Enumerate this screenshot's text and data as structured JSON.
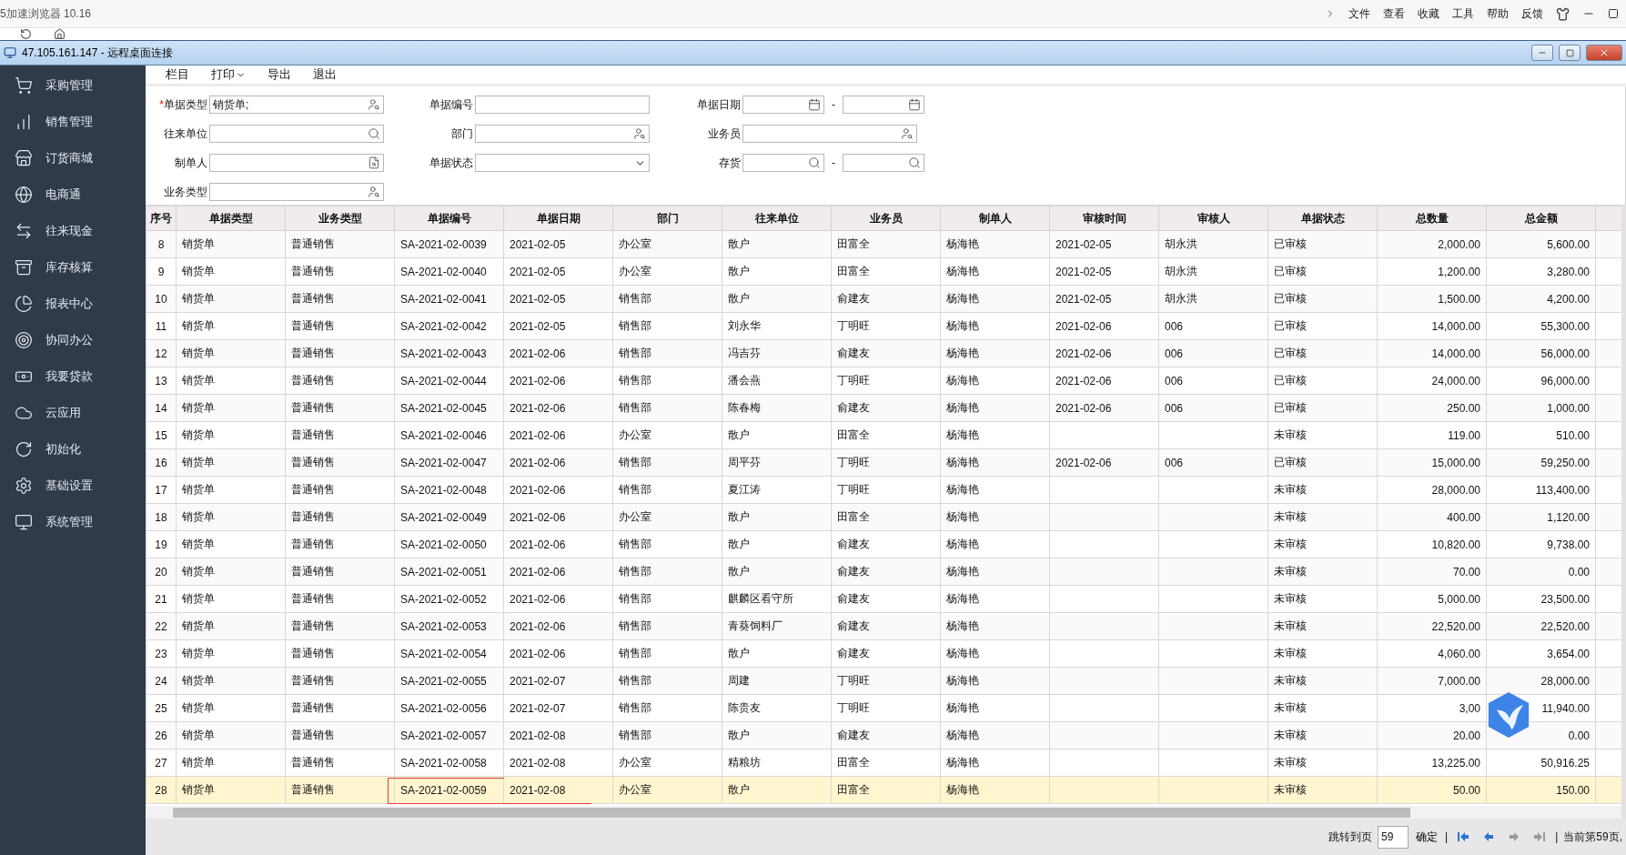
{
  "browser": {
    "title": "5加速浏览器 10.16",
    "menu": [
      "文件",
      "查看",
      "收藏",
      "工具",
      "帮助",
      "反馈"
    ]
  },
  "remote_window": {
    "title": "47.105.161.147 - 远程桌面连接"
  },
  "sidebar": {
    "items": [
      {
        "label": "采购管理"
      },
      {
        "label": "销售管理"
      },
      {
        "label": "订货商城"
      },
      {
        "label": "电商通"
      },
      {
        "label": "往来现金"
      },
      {
        "label": "库存核算"
      },
      {
        "label": "报表中心"
      },
      {
        "label": "协同办公"
      },
      {
        "label": "我要贷款"
      },
      {
        "label": "云应用"
      },
      {
        "label": "初始化"
      },
      {
        "label": "基础设置"
      },
      {
        "label": "系统管理"
      }
    ]
  },
  "toolbar": [
    {
      "label": "栏目",
      "dropdown": false
    },
    {
      "label": "打印",
      "dropdown": true
    },
    {
      "label": "导出",
      "dropdown": false
    },
    {
      "label": "退出",
      "dropdown": false
    }
  ],
  "filters": [
    {
      "required_mark": "*",
      "label": "单据类型",
      "kind": "lookup",
      "value": "销货单;"
    },
    {
      "label": "单据编号",
      "kind": "text"
    },
    {
      "label": "单据日期",
      "kind": "range",
      "separator": "-"
    },
    {
      "label": "往来单位",
      "kind": "lookup"
    },
    {
      "label": "部门",
      "kind": "lookup"
    },
    {
      "label": "业务员",
      "kind": "lookup"
    },
    {
      "label": "制单人",
      "kind": "lookup"
    },
    {
      "label": "单据状态",
      "kind": "select"
    },
    {
      "label": "存货",
      "kind": "range",
      "separator": "-"
    },
    {
      "label": "业务类型",
      "kind": "lookup"
    }
  ],
  "table": {
    "columns": [
      "序号",
      "单据类型",
      "业务类型",
      "单据编号",
      "单据日期",
      "部门",
      "往来单位",
      "业务员",
      "制单人",
      "审核时间",
      "审核人",
      "单据状态",
      "总数量",
      "总金额"
    ],
    "rows": [
      {
        "selected": false,
        "marked": false,
        "seq": "8",
        "doc_type": "销货单",
        "biz_type": "普通销售",
        "doc_no": "SA-2021-02-0039",
        "doc_date": "2021-02-05",
        "dept": "办公室",
        "partner": "散户",
        "salesman": "田富全",
        "maker": "杨海艳",
        "audit_time": "2021-02-05",
        "auditor": "胡永洪",
        "status": "已审核",
        "qty": "2,000.00",
        "amount": "5,600.00"
      },
      {
        "selected": false,
        "marked": false,
        "seq": "9",
        "doc_type": "销货单",
        "biz_type": "普通销售",
        "doc_no": "SA-2021-02-0040",
        "doc_date": "2021-02-05",
        "dept": "办公室",
        "partner": "散户",
        "salesman": "田富全",
        "maker": "杨海艳",
        "audit_time": "2021-02-05",
        "auditor": "胡永洪",
        "status": "已审核",
        "qty": "1,200.00",
        "amount": "3,280.00"
      },
      {
        "selected": false,
        "marked": false,
        "seq": "10",
        "doc_type": "销货单",
        "biz_type": "普通销售",
        "doc_no": "SA-2021-02-0041",
        "doc_date": "2021-02-05",
        "dept": "销售部",
        "partner": "散户",
        "salesman": "俞建友",
        "maker": "杨海艳",
        "audit_time": "2021-02-05",
        "auditor": "胡永洪",
        "status": "已审核",
        "qty": "1,500.00",
        "amount": "4,200.00"
      },
      {
        "selected": false,
        "marked": false,
        "seq": "11",
        "doc_type": "销货单",
        "biz_type": "普通销售",
        "doc_no": "SA-2021-02-0042",
        "doc_date": "2021-02-05",
        "dept": "销售部",
        "partner": "刘永华",
        "salesman": "丁明旺",
        "maker": "杨海艳",
        "audit_time": "2021-02-06",
        "auditor": "006",
        "status": "已审核",
        "qty": "14,000.00",
        "amount": "55,300.00"
      },
      {
        "selected": false,
        "marked": false,
        "seq": "12",
        "doc_type": "销货单",
        "biz_type": "普通销售",
        "doc_no": "SA-2021-02-0043",
        "doc_date": "2021-02-06",
        "dept": "销售部",
        "partner": "冯吉芬",
        "salesman": "俞建友",
        "maker": "杨海艳",
        "audit_time": "2021-02-06",
        "auditor": "006",
        "status": "已审核",
        "qty": "14,000.00",
        "amount": "56,000.00"
      },
      {
        "selected": false,
        "marked": false,
        "seq": "13",
        "doc_type": "销货单",
        "biz_type": "普通销售",
        "doc_no": "SA-2021-02-0044",
        "doc_date": "2021-02-06",
        "dept": "销售部",
        "partner": "潘会燕",
        "salesman": "丁明旺",
        "maker": "杨海艳",
        "audit_time": "2021-02-06",
        "auditor": "006",
        "status": "已审核",
        "qty": "24,000.00",
        "amount": "96,000.00"
      },
      {
        "selected": false,
        "marked": false,
        "seq": "14",
        "doc_type": "销货单",
        "biz_type": "普通销售",
        "doc_no": "SA-2021-02-0045",
        "doc_date": "2021-02-06",
        "dept": "销售部",
        "partner": "陈春梅",
        "salesman": "俞建友",
        "maker": "杨海艳",
        "audit_time": "2021-02-06",
        "auditor": "006",
        "status": "已审核",
        "qty": "250.00",
        "amount": "1,000.00"
      },
      {
        "selected": false,
        "marked": false,
        "seq": "15",
        "doc_type": "销货单",
        "biz_type": "普通销售",
        "doc_no": "SA-2021-02-0046",
        "doc_date": "2021-02-06",
        "dept": "办公室",
        "partner": "散户",
        "salesman": "田富全",
        "maker": "杨海艳",
        "status": "未审核",
        "qty": "119.00",
        "amount": "510.00"
      },
      {
        "selected": false,
        "marked": false,
        "seq": "16",
        "doc_type": "销货单",
        "biz_type": "普通销售",
        "doc_no": "SA-2021-02-0047",
        "doc_date": "2021-02-06",
        "dept": "销售部",
        "partner": "周平芬",
        "salesman": "丁明旺",
        "maker": "杨海艳",
        "audit_time": "2021-02-06",
        "auditor": "006",
        "status": "已审核",
        "qty": "15,000.00",
        "amount": "59,250.00"
      },
      {
        "selected": false,
        "marked": false,
        "seq": "17",
        "doc_type": "销货单",
        "biz_type": "普通销售",
        "doc_no": "SA-2021-02-0048",
        "doc_date": "2021-02-06",
        "dept": "销售部",
        "partner": "夏江涛",
        "salesman": "丁明旺",
        "maker": "杨海艳",
        "status": "未审核",
        "qty": "28,000.00",
        "amount": "113,400.00"
      },
      {
        "selected": false,
        "marked": false,
        "seq": "18",
        "doc_type": "销货单",
        "biz_type": "普通销售",
        "doc_no": "SA-2021-02-0049",
        "doc_date": "2021-02-06",
        "dept": "办公室",
        "partner": "散户",
        "salesman": "田富全",
        "maker": "杨海艳",
        "status": "未审核",
        "qty": "400.00",
        "amount": "1,120.00"
      },
      {
        "selected": false,
        "marked": false,
        "seq": "19",
        "doc_type": "销货单",
        "biz_type": "普通销售",
        "doc_no": "SA-2021-02-0050",
        "doc_date": "2021-02-06",
        "dept": "销售部",
        "partner": "散户",
        "salesman": "俞建友",
        "maker": "杨海艳",
        "status": "未审核",
        "qty": "10,820.00",
        "amount": "9,738.00"
      },
      {
        "selected": false,
        "marked": false,
        "seq": "20",
        "doc_type": "销货单",
        "biz_type": "普通销售",
        "doc_no": "SA-2021-02-0051",
        "doc_date": "2021-02-06",
        "dept": "销售部",
        "partner": "散户",
        "salesman": "俞建友",
        "maker": "杨海艳",
        "status": "未审核",
        "qty": "70.00",
        "amount": "0.00"
      },
      {
        "selected": false,
        "marked": false,
        "seq": "21",
        "doc_type": "销货单",
        "biz_type": "普通销售",
        "doc_no": "SA-2021-02-0052",
        "doc_date": "2021-02-06",
        "dept": "销售部",
        "partner": "麒麟区看守所",
        "salesman": "俞建友",
        "maker": "杨海艳",
        "status": "未审核",
        "qty": "5,000.00",
        "amount": "23,500.00"
      },
      {
        "selected": false,
        "marked": false,
        "seq": "22",
        "doc_type": "销货单",
        "biz_type": "普通销售",
        "doc_no": "SA-2021-02-0053",
        "doc_date": "2021-02-06",
        "dept": "销售部",
        "partner": "青葵饲料厂",
        "salesman": "俞建友",
        "maker": "杨海艳",
        "status": "未审核",
        "qty": "22,520.00",
        "amount": "22,520.00"
      },
      {
        "selected": false,
        "marked": false,
        "seq": "23",
        "doc_type": "销货单",
        "biz_type": "普通销售",
        "doc_no": "SA-2021-02-0054",
        "doc_date": "2021-02-06",
        "dept": "销售部",
        "partner": "散户",
        "salesman": "俞建友",
        "maker": "杨海艳",
        "status": "未审核",
        "qty": "4,060.00",
        "amount": "3,654.00"
      },
      {
        "selected": false,
        "marked": false,
        "seq": "24",
        "doc_type": "销货单",
        "biz_type": "普通销售",
        "doc_no": "SA-2021-02-0055",
        "doc_date": "2021-02-07",
        "dept": "销售部",
        "partner": "周建",
        "salesman": "丁明旺",
        "maker": "杨海艳",
        "status": "未审核",
        "qty": "7,000.00",
        "amount": "28,000.00"
      },
      {
        "selected": false,
        "marked": false,
        "seq": "25",
        "doc_type": "销货单",
        "biz_type": "普通销售",
        "doc_no": "SA-2021-02-0056",
        "doc_date": "2021-02-07",
        "dept": "销售部",
        "partner": "陈贵友",
        "salesman": "丁明旺",
        "maker": "杨海艳",
        "status": "未审核",
        "qty": "3,00",
        "amount": "11,940.00"
      },
      {
        "selected": false,
        "marked": false,
        "seq": "26",
        "doc_type": "销货单",
        "biz_type": "普通销售",
        "doc_no": "SA-2021-02-0057",
        "doc_date": "2021-02-08",
        "dept": "销售部",
        "partner": "散户",
        "salesman": "俞建友",
        "maker": "杨海艳",
        "status": "未审核",
        "qty": "20.00",
        "amount": "0.00"
      },
      {
        "selected": false,
        "marked": false,
        "seq": "27",
        "doc_type": "销货单",
        "biz_type": "普通销售",
        "doc_no": "SA-2021-02-0058",
        "doc_date": "2021-02-08",
        "dept": "办公室",
        "partner": "精粮坊",
        "salesman": "田富全",
        "maker": "杨海艳",
        "status": "未审核",
        "qty": "13,225.00",
        "amount": "50,916.25"
      },
      {
        "selected": true,
        "marked": true,
        "seq": "28",
        "doc_type": "销货单",
        "biz_type": "普通销售",
        "doc_no": "SA-2021-02-0059",
        "doc_date": "2021-02-08",
        "dept": "办公室",
        "partner": "散户",
        "salesman": "田富全",
        "maker": "杨海艳",
        "status": "未审核",
        "qty": "50.00",
        "amount": "150.00"
      }
    ]
  },
  "pager": {
    "jump_label": "跳转到页",
    "page": "59",
    "confirm": "确定",
    "separator_1": "|",
    "nav": [
      {
        "kind": "first",
        "disabled": false
      },
      {
        "kind": "prev",
        "disabled": false
      },
      {
        "kind": "next",
        "disabled": true
      },
      {
        "kind": "last",
        "disabled": true
      }
    ],
    "separator_2": "|",
    "status": "当前第59页,"
  }
}
